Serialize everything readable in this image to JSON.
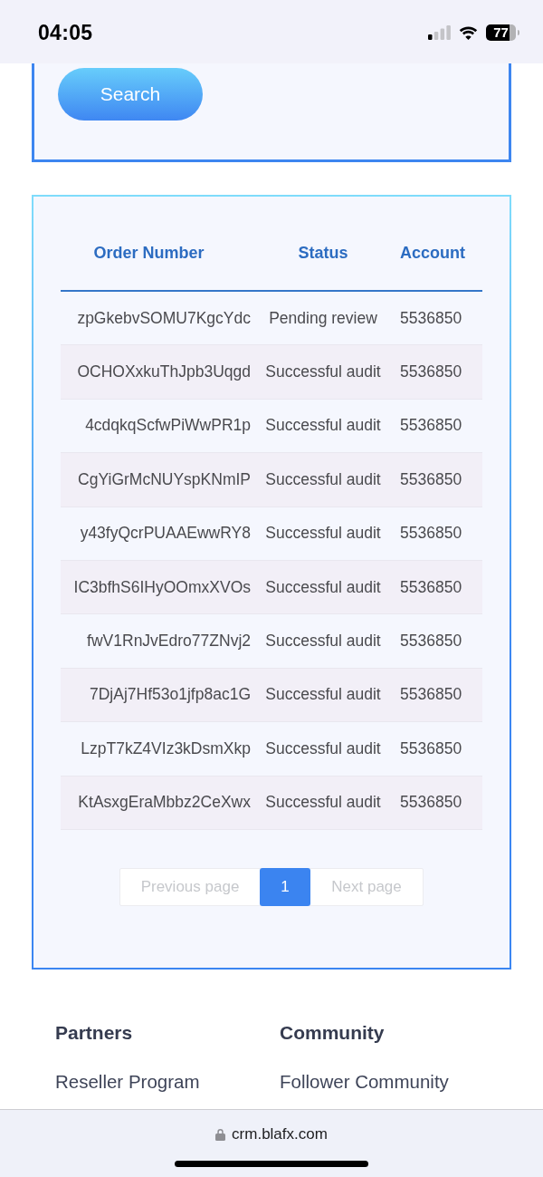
{
  "status_bar": {
    "time": "04:05",
    "battery": "77"
  },
  "search_panel": {
    "button": "Search"
  },
  "orders_table": {
    "columns": [
      "Order Number",
      "Status",
      "Account"
    ],
    "rows": [
      {
        "order_number": "zpGkebvSOMU7KgcYdc",
        "status": "Pending review",
        "account": "5536850"
      },
      {
        "order_number": "OCHOXxkuThJpb3Uqgd",
        "status": "Successful audit",
        "account": "5536850"
      },
      {
        "order_number": "4cdqkqScfwPiWwPR1p",
        "status": "Successful audit",
        "account": "5536850"
      },
      {
        "order_number": "CgYiGrMcNUYspKNmIP",
        "status": "Successful audit",
        "account": "5536850"
      },
      {
        "order_number": "y43fyQcrPUAAEwwRY8",
        "status": "Successful audit",
        "account": "5536850"
      },
      {
        "order_number": "IC3bfhS6IHyOOmxXVOs",
        "status": "Successful audit",
        "account": "5536850"
      },
      {
        "order_number": "fwV1RnJvEdro77ZNvj2",
        "status": "Successful audit",
        "account": "5536850"
      },
      {
        "order_number": "7DjAj7Hf53o1jfp8ac1G",
        "status": "Successful audit",
        "account": "5536850"
      },
      {
        "order_number": "LzpT7kZ4VIz3kDsmXkp",
        "status": "Successful audit",
        "account": "5536850"
      },
      {
        "order_number": "KtAsxgEraMbbz2CeXwx",
        "status": "Successful audit",
        "account": "5536850"
      }
    ]
  },
  "pagination": {
    "previous": {
      "label": "Previous page",
      "disabled": true
    },
    "pages": [
      {
        "label": "1",
        "selected": true
      }
    ],
    "next": {
      "label": "Next page",
      "disabled": true
    }
  },
  "footer": {
    "columns": [
      {
        "heading": "Partners",
        "links": [
          "Reseller Program"
        ]
      },
      {
        "heading": "Community",
        "links": [
          "Follower Community"
        ]
      }
    ]
  },
  "browser_bar": {
    "url": "crm.blafx.com"
  }
}
